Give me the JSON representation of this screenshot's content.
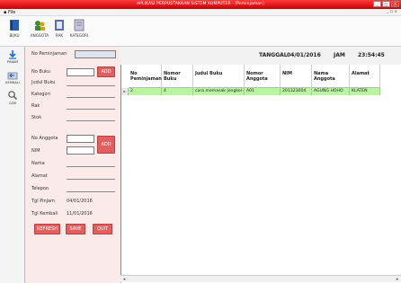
{
  "window": {
    "title": "APLIKASI PERPUSTAKAAN SISTEM KOMPUTER - [Peminjaman]",
    "min": "_",
    "max": "□",
    "close": "X"
  },
  "menubar": {
    "file": "▪ File",
    "right": "_ ▫ ×"
  },
  "toolbar": {
    "buku": "BUKU",
    "anggota": "ANGGOTA",
    "rak": "RAK",
    "kategori": "KATEGORI"
  },
  "sidenav": {
    "pinjam": "PINJAM",
    "kembali": "KEMBALI",
    "cari": "CARI"
  },
  "form": {
    "no_peminjaman_label": "No Peminjaman",
    "no_buku_label": "No Buku",
    "judul_label": "Judul Buku",
    "kategori_label": "Kategori",
    "rak_label": "Rak",
    "stok_label": "Stok",
    "no_anggota_label": "No Anggota",
    "nim_label": "NIM",
    "nama_label": "Nama",
    "alamat_label": "Alamat",
    "telepon_label": "Telepon",
    "tgl_pinjam_label": "Tgl Pinjam",
    "tgl_pinjam_value": "04/01/2016",
    "tgl_kembali_label": "Tgl Kembali",
    "tgl_kembali_value": "11/01/2016",
    "add_buku": "ADD",
    "add_anggota": "ADD",
    "refresh": "REFRESH",
    "save": "SAVE",
    "quit": "QUIT"
  },
  "header": {
    "tanggal_label": "TANGGAL",
    "tanggal_value": "04/01/2016",
    "jam_label": "JAM",
    "jam_value": "23:54:45"
  },
  "table": {
    "columns": [
      "No Peminjaman",
      "Nomor Buku",
      "Judul Buku",
      "Nomor Anggota",
      "NIM",
      "Nama Anggota",
      "Alamat"
    ],
    "rows": [
      [
        "2",
        "4",
        "cara memasak jengkol do",
        "A01",
        "201323004",
        "AGUNG HOHO",
        "KLATEN"
      ]
    ],
    "row_marker": "▸"
  },
  "colors": {
    "title_red": "#d40000",
    "form_bg": "#fbeaea",
    "button_red": "#e06060",
    "row_green": "#b9f5a0"
  }
}
